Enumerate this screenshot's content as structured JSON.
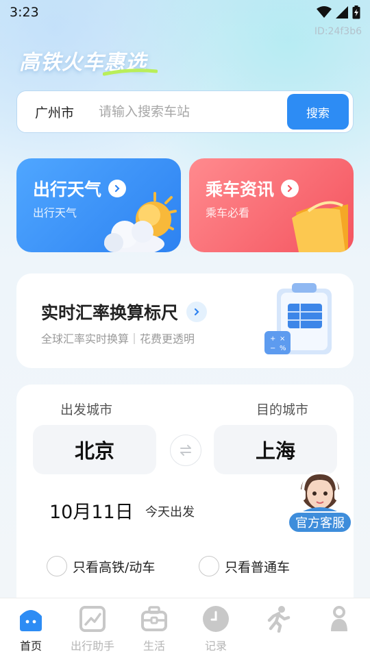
{
  "status_bar": {
    "time": "3:23"
  },
  "id_label": "ID:24f3b6",
  "app_title": "高铁火车惠选",
  "search": {
    "city": "广州市",
    "placeholder": "请输入搜索车站",
    "button_label": "搜索"
  },
  "cards": {
    "weather": {
      "title": "出行天气",
      "subtitle": "出行天气"
    },
    "news": {
      "title": "乘车资讯",
      "subtitle": "乘车必看"
    }
  },
  "rate_card": {
    "title": "实时汇率换算标尺",
    "subtitle": "全球汇率实时换算｜花费更透明"
  },
  "trip": {
    "from_label": "出发城市",
    "to_label": "目的城市",
    "from_city": "北京",
    "to_city": "上海",
    "date": "10月11日",
    "date_note": "今天出发",
    "filter_highspeed": "只看高铁/动车",
    "filter_normal": "只看普通车"
  },
  "service_label": "官方客服",
  "tabs": [
    {
      "label": "首页",
      "icon": "home-icon",
      "active": true
    },
    {
      "label": "出行助手",
      "icon": "chart-icon",
      "active": false
    },
    {
      "label": "生活",
      "icon": "briefcase-icon",
      "active": false
    },
    {
      "label": "记录",
      "icon": "clock-icon",
      "active": false
    },
    {
      "label": "",
      "icon": "runner-icon",
      "active": false
    },
    {
      "label": "",
      "icon": "person-icon",
      "active": false
    }
  ],
  "colors": {
    "accent": "#2d8cf4",
    "weather_card": "#3d92f8",
    "news_card": "#f76670",
    "service": "#3e8ddb"
  }
}
